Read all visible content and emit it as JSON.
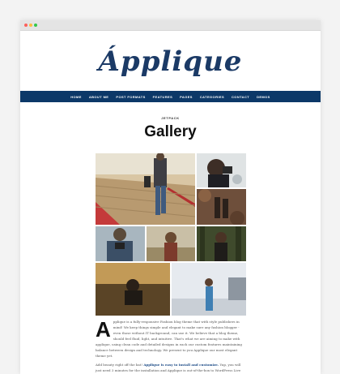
{
  "brand": {
    "logo_text": "Ápplique"
  },
  "nav": {
    "items": [
      "HOME",
      "ABOUT ME",
      "POST FORMATS",
      "FEATURES",
      "PAGES",
      "CATEGORIES",
      "CONTACT",
      "DEMOS"
    ]
  },
  "post": {
    "category": "JETPACK",
    "title": "Gallery"
  },
  "gallery": {
    "icons": [
      "photo-boardwalk",
      "photo-girl-camera",
      "photo-boots",
      "photo-man-camera",
      "photo-woman-field",
      "photo-woman-forest",
      "photo-sitting-field",
      "photo-woman-bridge"
    ]
  },
  "article": {
    "dropcap": "A",
    "p1": "pplique is a fully-responsive Fashion blog theme that with style publishers in mind! We keep things simple and elegant to make sure any fashion blogger - even those without IT background, can use it. We believe that a blog theme, should feel fluid, light, and intuitive. That's what we are aiming to make with applique, using clean code and detailed designs in each our custom features maintaining balance between design and technology. We present to you Applique our most elegant theme yet.",
    "p2_before": "Add beauty right off the bat!",
    "p2_link": "Applique is easy to install and customize.",
    "p2_after": "Yup, you will just need 3 minutes for the installation and Applique is out-of-the-box to WordPress Live Customizer. No"
  },
  "colors": {
    "brand": "#1b3a66",
    "nav_bg": "#0c3868",
    "link": "#1b4a86"
  }
}
